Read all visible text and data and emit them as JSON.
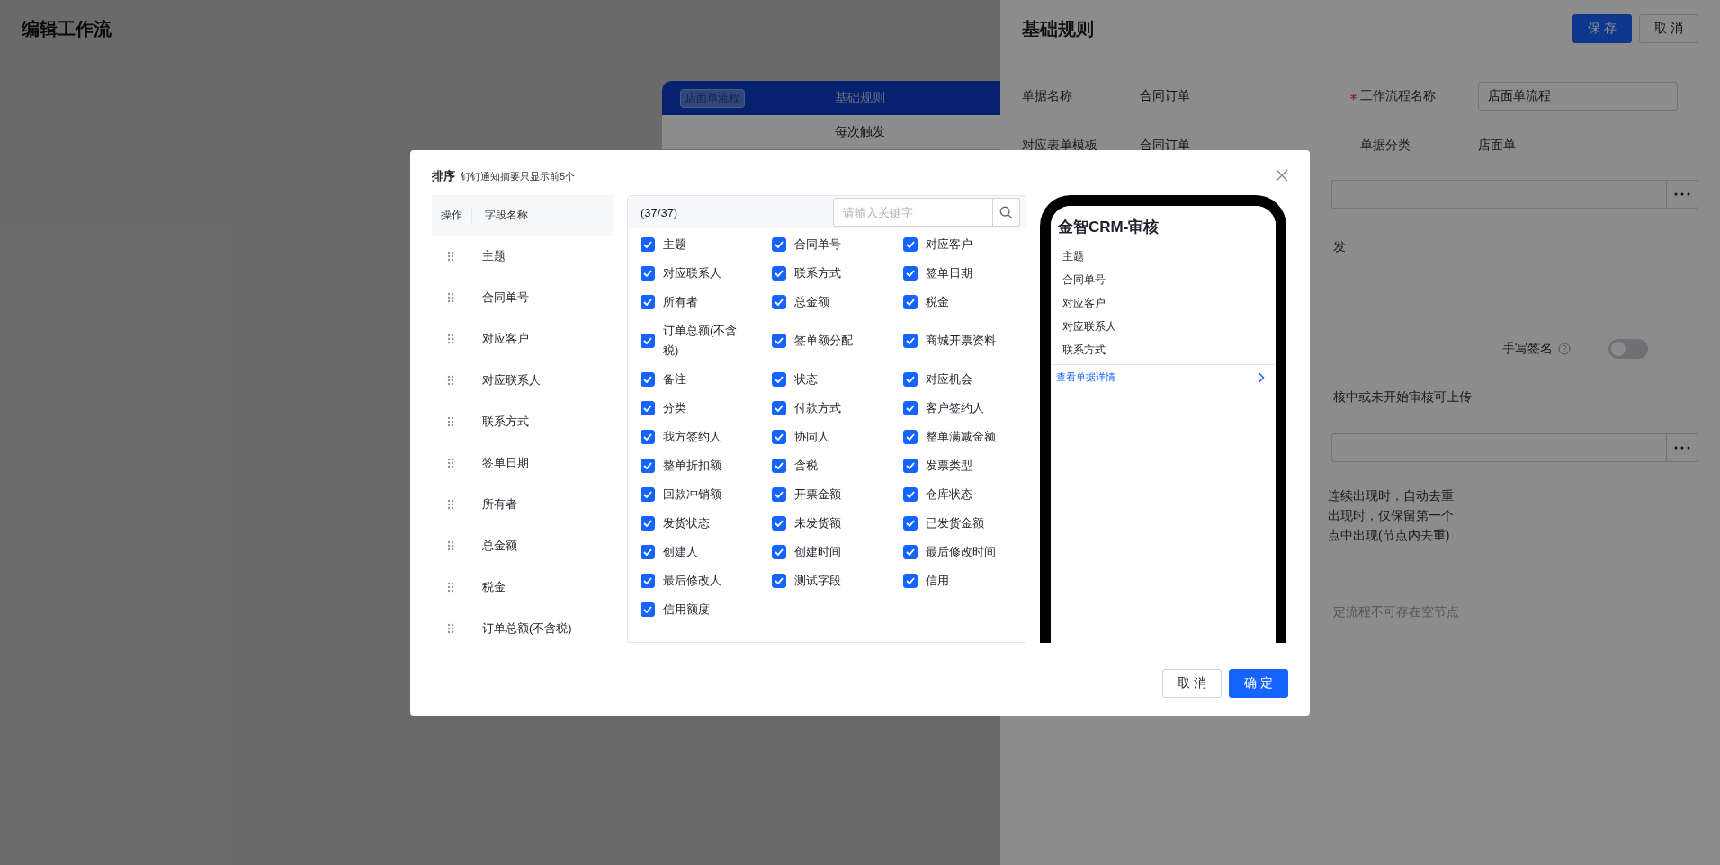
{
  "page": {
    "title": "编辑工作流"
  },
  "flow_card": {
    "tag": "店面单流程",
    "header": "基础规则",
    "row": "每次触发"
  },
  "panel": {
    "title": "基础规则",
    "buttons": [
      {
        "label": "保 存",
        "kind": "primary"
      },
      {
        "label": "取 消",
        "kind": "default"
      }
    ],
    "info_rows": [
      [
        {
          "label": "单据名称",
          "value": "合同订单",
          "kind": "text",
          "required": false
        },
        {
          "label": "工作流程名称",
          "value": "店面单流程",
          "kind": "input",
          "required": true
        }
      ],
      [
        {
          "label": "对应表单模板",
          "value": "合同订单",
          "kind": "text",
          "required": false
        },
        {
          "label": "单据分类",
          "value": "店面单",
          "kind": "text",
          "required": false
        }
      ]
    ],
    "trigger_text": "发",
    "signature": {
      "label": "手写签名",
      "on": false
    },
    "upload_note": "核中或未开始审核可上传",
    "dedupe_lines": [
      "连续出现时，自动去重",
      "出现时，仅保留第一个",
      "点中出现(节点内去重)"
    ],
    "empty_node_note": "定流程不可存在空节点"
  },
  "modal": {
    "title": "排序",
    "subtitle": "钉钉通知摘要只显示前5个",
    "sort_table": {
      "columns": [
        "操作",
        "字段名称"
      ],
      "rows": [
        "主题",
        "合同单号",
        "对应客户",
        "对应联系人",
        "联系方式",
        "签单日期",
        "所有者",
        "总金额",
        "税金",
        "订单总额(不含税)"
      ]
    },
    "field_picker": {
      "count": "(37/37)",
      "search": {
        "placeholder": "请输入关键字"
      },
      "fields": [
        {
          "label": "主题",
          "checked": true
        },
        {
          "label": "合同单号",
          "checked": true
        },
        {
          "label": "对应客户",
          "checked": true
        },
        {
          "label": "对应联系人",
          "checked": true
        },
        {
          "label": "联系方式",
          "checked": true
        },
        {
          "label": "签单日期",
          "checked": true
        },
        {
          "label": "所有者",
          "checked": true
        },
        {
          "label": "总金额",
          "checked": true
        },
        {
          "label": "税金",
          "checked": true
        },
        {
          "label": "订单总额(不含税)",
          "checked": true
        },
        {
          "label": "签单额分配",
          "checked": true
        },
        {
          "label": "商城开票资料",
          "checked": true
        },
        {
          "label": "备注",
          "checked": true
        },
        {
          "label": "状态",
          "checked": true
        },
        {
          "label": "对应机会",
          "checked": true
        },
        {
          "label": "分类",
          "checked": true
        },
        {
          "label": "付款方式",
          "checked": true
        },
        {
          "label": "客户签约人",
          "checked": true
        },
        {
          "label": "我方签约人",
          "checked": true
        },
        {
          "label": "协同人",
          "checked": true
        },
        {
          "label": "整单满减金额",
          "checked": true
        },
        {
          "label": "整单折扣额",
          "checked": true
        },
        {
          "label": "含税",
          "checked": true
        },
        {
          "label": "发票类型",
          "checked": true
        },
        {
          "label": "回款冲销额",
          "checked": true
        },
        {
          "label": "开票金额",
          "checked": true
        },
        {
          "label": "仓库状态",
          "checked": true
        },
        {
          "label": "发货状态",
          "checked": true
        },
        {
          "label": "未发货额",
          "checked": true
        },
        {
          "label": "已发货金额",
          "checked": true
        },
        {
          "label": "创建人",
          "checked": true
        },
        {
          "label": "创建时间",
          "checked": true
        },
        {
          "label": "最后修改时间",
          "checked": true
        },
        {
          "label": "最后修改人",
          "checked": true
        },
        {
          "label": "测试字段",
          "checked": true
        },
        {
          "label": "信用",
          "checked": true
        },
        {
          "label": "信用额度",
          "checked": true
        }
      ]
    },
    "preview": {
      "title": "金智CRM-审核",
      "items": [
        "主题",
        "合同单号",
        "对应客户",
        "对应联系人",
        "联系方式"
      ],
      "link": "查看单据详情"
    },
    "buttons": [
      {
        "label": "取 消",
        "kind": "default"
      },
      {
        "label": "确 定",
        "kind": "primary"
      }
    ]
  }
}
